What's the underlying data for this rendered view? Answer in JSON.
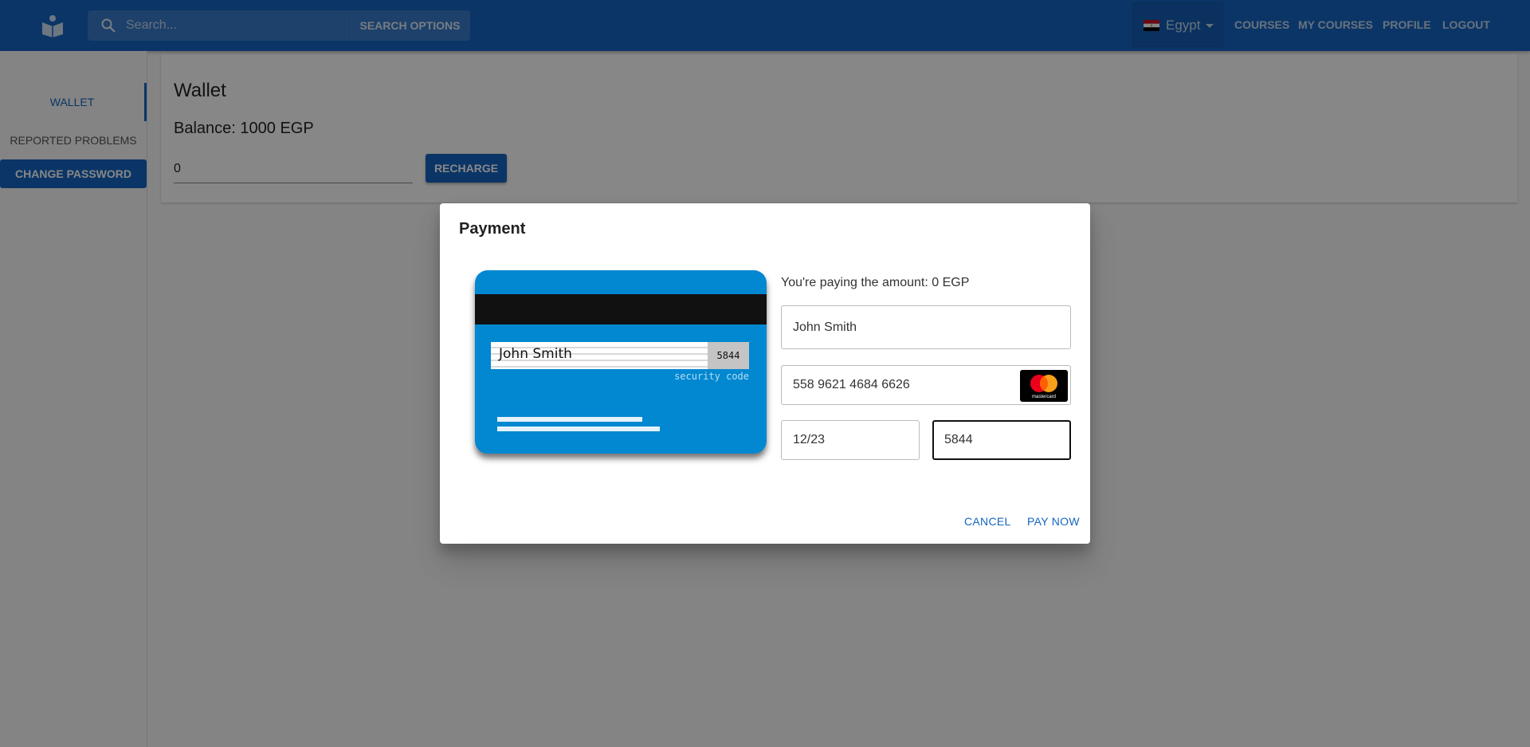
{
  "header": {
    "search_placeholder": "Search...",
    "search_options_label": "Search Options",
    "country": "Egypt",
    "nav": {
      "courses": "Courses",
      "my_courses": "My Courses",
      "profile": "Profile",
      "logout": "Logout"
    }
  },
  "sidebar": {
    "items": [
      {
        "label": "Wallet",
        "active": true
      },
      {
        "label": "Reported Problems"
      },
      {
        "label": "Change Password"
      }
    ]
  },
  "wallet": {
    "title": "Wallet",
    "balance": "Balance: 1000 EGP",
    "amount_value": "0",
    "recharge_label": "Recharge"
  },
  "dialog": {
    "title": "Payment",
    "paying_text": "You're paying the amount: 0 EGP",
    "card_preview": {
      "name": "John Smith",
      "cvc": "5844",
      "security_label": "security code"
    },
    "fields": {
      "name": "John Smith",
      "number": "558 9621 4684 6626",
      "expiry": "12/23",
      "cvc": "5844"
    },
    "card_brand_text": "mastercard",
    "cancel_label": "Cancel",
    "pay_label": "Pay Now"
  },
  "colors": {
    "primary": "#1565c0",
    "card_blue": "#0288d1"
  }
}
